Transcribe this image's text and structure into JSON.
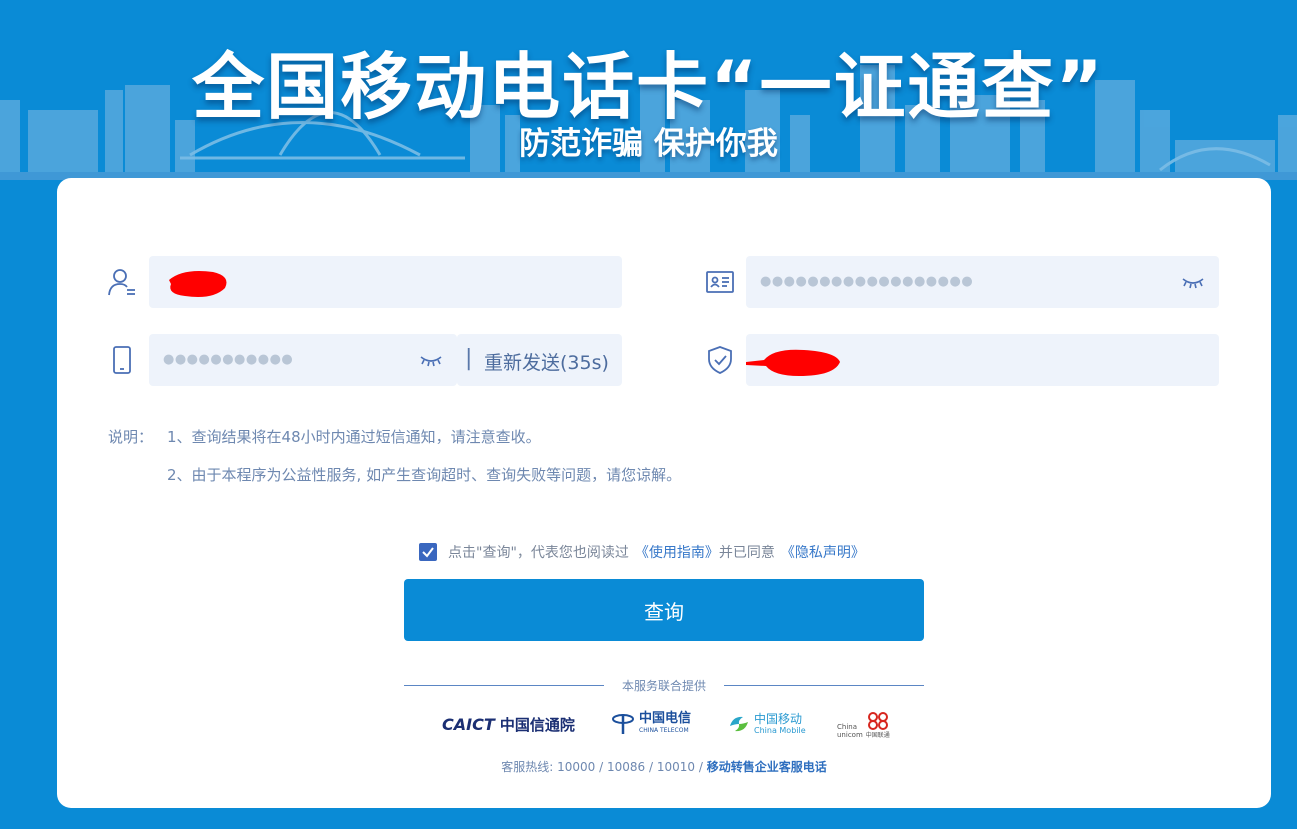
{
  "banner": {
    "title": "全国移动电话卡“一证通查”",
    "subtitle": "防范诈骗 保护你我"
  },
  "form": {
    "id_number_mask": "●●●●●●●●●●●●●●●●●●",
    "phone_mask": "●●●●●●●●●●●",
    "resend_separator": "|",
    "resend_label": "重新发送(35s)"
  },
  "notes": {
    "label": "说明：",
    "items": [
      "1、查询结果将在48小时内通过短信通知，请注意查收。",
      "2、由于本程序为公益性服务, 如产生查询超时、查询失败等问题，请您谅解。"
    ]
  },
  "agreement": {
    "text": "点击\"查询\"，代表您也阅读过",
    "guide_link": "《使用指南》",
    "and_text": "并已同意",
    "privacy_link": "《隐私声明》",
    "checked": true
  },
  "submit_label": "查询",
  "providers": {
    "heading": "本服务联合提供",
    "caict": {
      "mark": "CAICT",
      "name": "中国信通院"
    },
    "telecom": {
      "name": "中国电信",
      "en": "CHINA TELECOM"
    },
    "mobile": {
      "name": "中国移动",
      "en": "China Mobile"
    },
    "unicom": {
      "en1": "China",
      "en2": "unicom",
      "name": "中国联通"
    }
  },
  "hotline": {
    "label": "客服热线: 10000 / 10086 / 10010 /",
    "link": "移动转售企业客服电话"
  },
  "colors": {
    "brand_blue": "#0a8bd6",
    "input_bg": "#eef3fb",
    "checkbox": "#3a67bf",
    "link": "#3778c9",
    "redaction": "#ff0000"
  }
}
